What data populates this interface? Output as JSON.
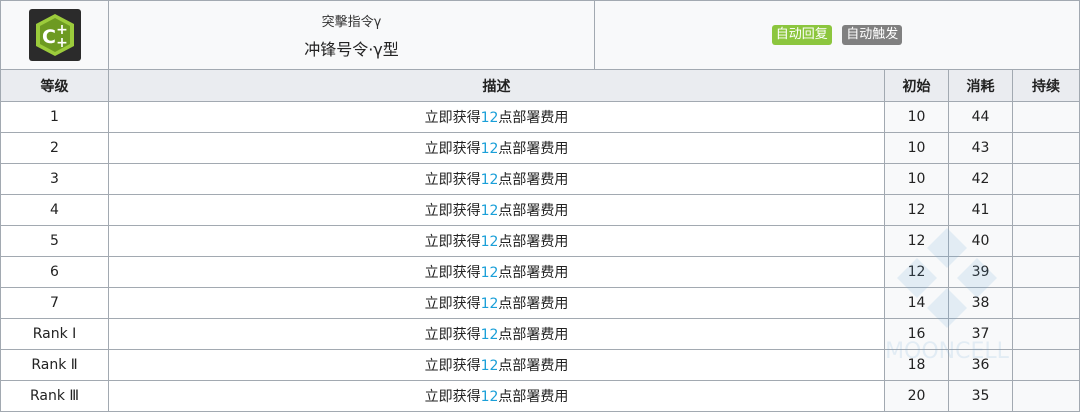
{
  "skill": {
    "icon": "skill-gear-plus-icon",
    "subtitle": "突擊指令γ",
    "name": "冲锋号令·γ型",
    "badges": [
      {
        "label": "自动回复",
        "color": "#8cc63e"
      },
      {
        "label": "自动触发",
        "color": "#808080"
      }
    ]
  },
  "columns": {
    "level": "等级",
    "desc": "描述",
    "initial": "初始",
    "cost": "消耗",
    "duration": "持续"
  },
  "rows": [
    {
      "level": "1",
      "desc_pre": "立即获得",
      "desc_num": "12",
      "desc_post": "点部署费用",
      "initial": "10",
      "cost": "44",
      "duration": ""
    },
    {
      "level": "2",
      "desc_pre": "立即获得",
      "desc_num": "12",
      "desc_post": "点部署费用",
      "initial": "10",
      "cost": "43",
      "duration": ""
    },
    {
      "level": "3",
      "desc_pre": "立即获得",
      "desc_num": "12",
      "desc_post": "点部署费用",
      "initial": "10",
      "cost": "42",
      "duration": ""
    },
    {
      "level": "4",
      "desc_pre": "立即获得",
      "desc_num": "12",
      "desc_post": "点部署费用",
      "initial": "12",
      "cost": "41",
      "duration": ""
    },
    {
      "level": "5",
      "desc_pre": "立即获得",
      "desc_num": "12",
      "desc_post": "点部署费用",
      "initial": "12",
      "cost": "40",
      "duration": ""
    },
    {
      "level": "6",
      "desc_pre": "立即获得",
      "desc_num": "12",
      "desc_post": "点部署费用",
      "initial": "12",
      "cost": "39",
      "duration": ""
    },
    {
      "level": "7",
      "desc_pre": "立即获得",
      "desc_num": "12",
      "desc_post": "点部署费用",
      "initial": "14",
      "cost": "38",
      "duration": ""
    },
    {
      "level": "Rank Ⅰ",
      "desc_pre": "立即获得",
      "desc_num": "12",
      "desc_post": "点部署费用",
      "initial": "16",
      "cost": "37",
      "duration": ""
    },
    {
      "level": "Rank Ⅱ",
      "desc_pre": "立即获得",
      "desc_num": "12",
      "desc_post": "点部署费用",
      "initial": "18",
      "cost": "36",
      "duration": ""
    },
    {
      "level": "Rank Ⅲ",
      "desc_pre": "立即获得",
      "desc_num": "12",
      "desc_post": "点部署费用",
      "initial": "20",
      "cost": "35",
      "duration": ""
    }
  ],
  "watermark": {
    "text": "MOONCELL",
    "color": "#6aa6d6"
  },
  "colors": {
    "highlight": "#1a9fd8",
    "border": "#a2a9b1",
    "header_bg": "#eaecf0"
  }
}
